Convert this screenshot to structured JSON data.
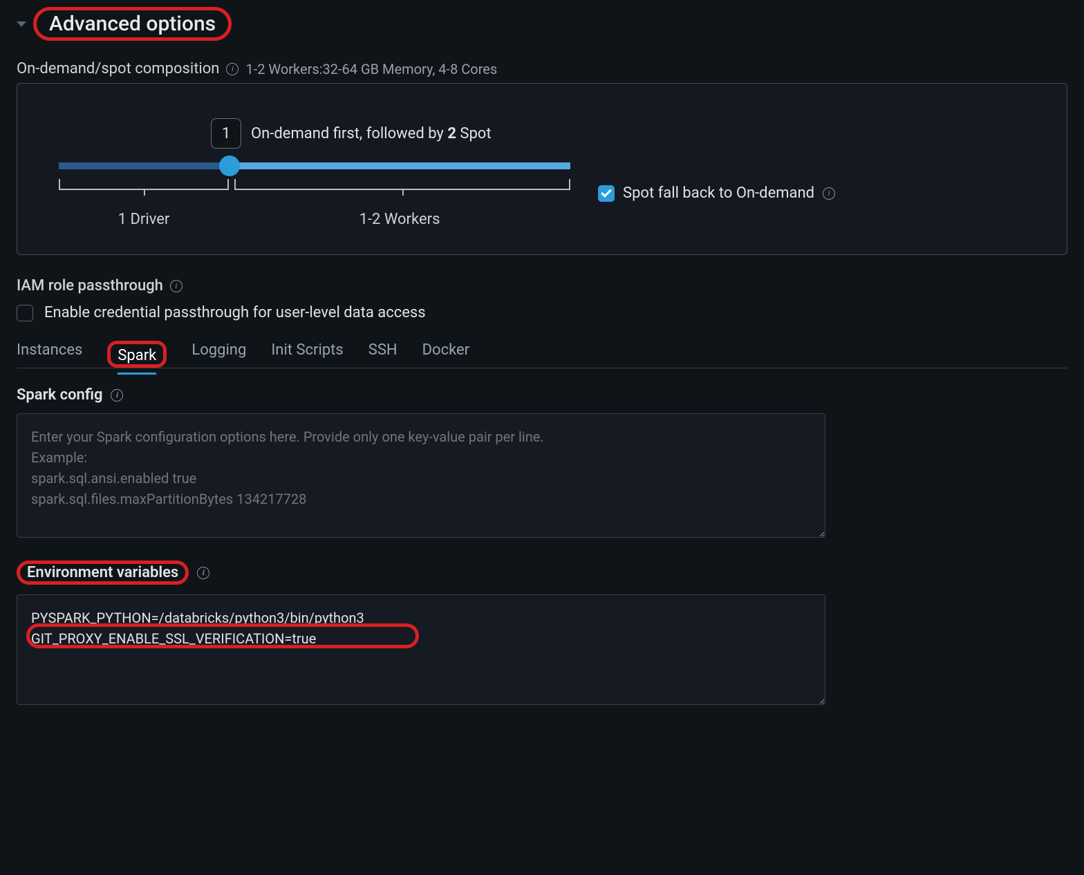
{
  "header": {
    "title": "Advanced options"
  },
  "composition": {
    "label": "On-demand/spot composition",
    "meta": "1-2 Workers:32-64 GB Memory, 4-8 Cores",
    "slider_count": "1",
    "slider_text_prefix": "On-demand first, followed by ",
    "slider_text_bold": "2",
    "slider_text_suffix": " Spot",
    "bracket1_label": "1 Driver",
    "bracket2_label": "1-2 Workers",
    "fallback_label": "Spot fall back to On-demand"
  },
  "iam": {
    "label": "IAM role passthrough",
    "checkbox_label": "Enable credential passthrough for user-level data access"
  },
  "tabs": {
    "items": [
      "Instances",
      "Spark",
      "Logging",
      "Init Scripts",
      "SSH",
      "Docker"
    ],
    "active": "Spark"
  },
  "spark_config": {
    "heading": "Spark config",
    "placeholder": "Enter your Spark configuration options here. Provide only one key-value pair per line.\nExample:\nspark.sql.ansi.enabled true\nspark.sql.files.maxPartitionBytes 134217728"
  },
  "env_vars": {
    "heading": "Environment variables",
    "value": "PYSPARK_PYTHON=/databricks/python3/bin/python3\nGIT_PROXY_ENABLE_SSL_VERIFICATION=true"
  }
}
